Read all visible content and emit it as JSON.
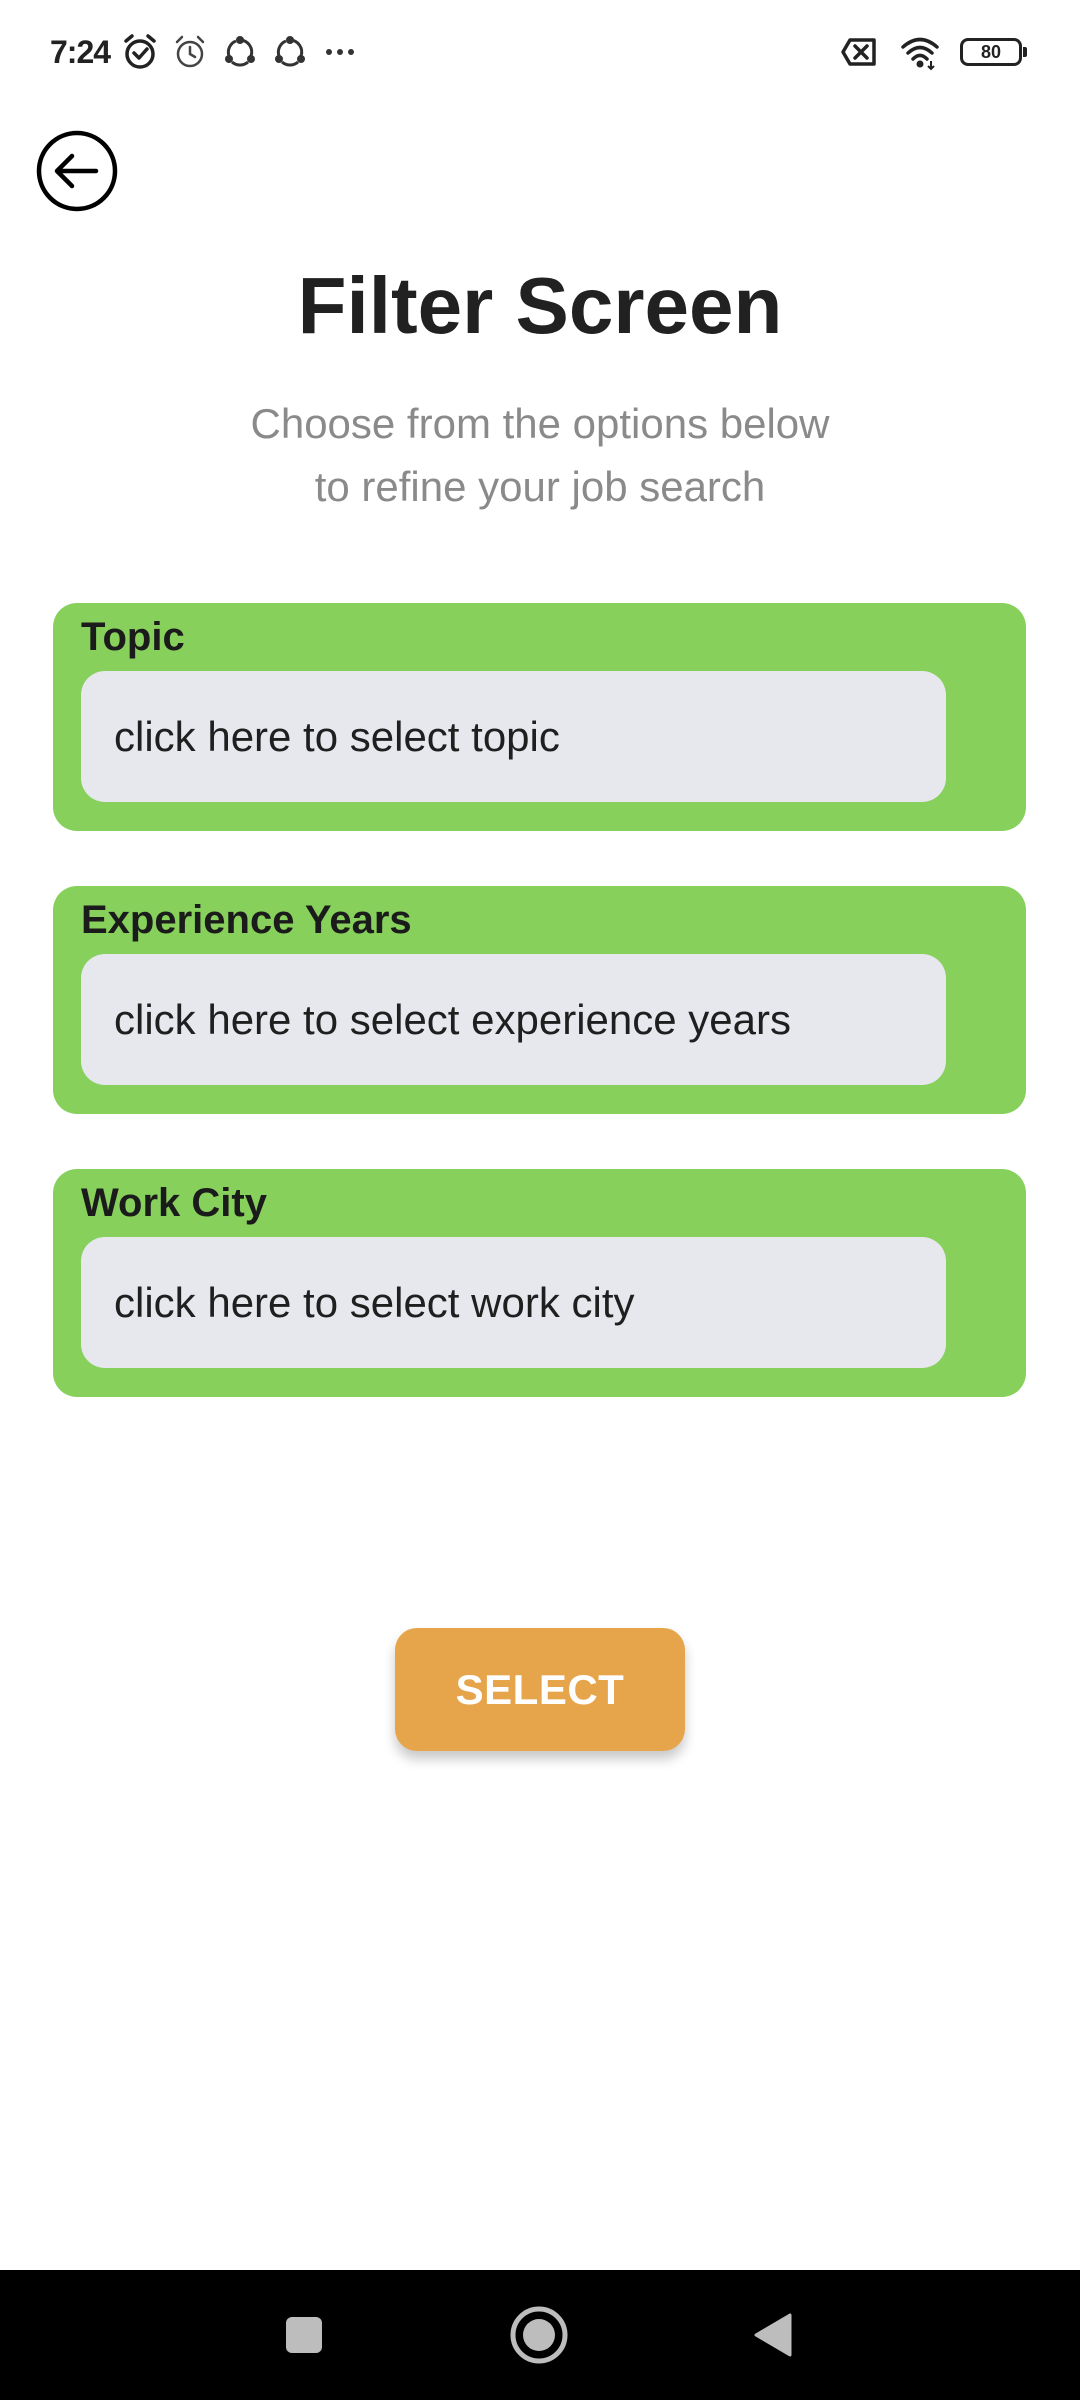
{
  "status_bar": {
    "time": "7:24",
    "battery_level": "80",
    "icons": [
      "alarm-clock-icon",
      "alarm-icon",
      "sync-icon",
      "sync-icon",
      "more-dots-icon",
      "no-sim-icon",
      "wifi-icon",
      "battery-icon"
    ]
  },
  "header": {
    "back_icon": "back-arrow-icon",
    "title": "Filter Screen",
    "subtitle_line1": "Choose from the options below",
    "subtitle_line2": "to refine your job search"
  },
  "filters": [
    {
      "label": "Topic",
      "placeholder": "click here to select topic"
    },
    {
      "label": "Experience Years",
      "placeholder": "click here to select experience years"
    },
    {
      "label": "Work City",
      "placeholder": "click here to select work city"
    }
  ],
  "actions": {
    "select_label": "SELECT"
  },
  "nav_bar": {
    "buttons": [
      "recent-apps-icon",
      "home-icon",
      "back-triangle-icon"
    ]
  },
  "colors": {
    "card_green": "#86d05b",
    "field_gray": "#e6e8ee",
    "button_orange": "#e7a54b",
    "subtitle_gray": "#8a8a8a",
    "title_dark": "#212121"
  }
}
